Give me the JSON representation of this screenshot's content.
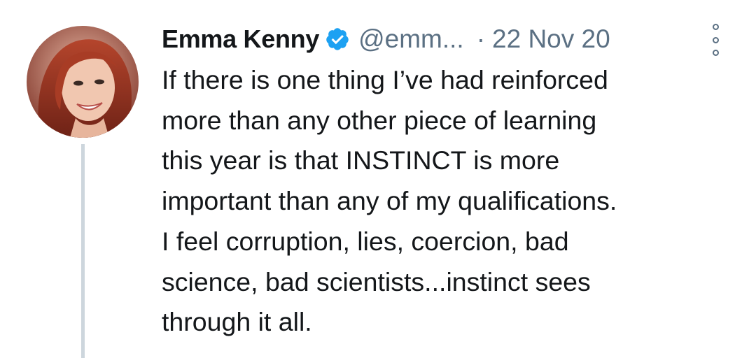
{
  "tweet": {
    "author": {
      "name": "Emma Kenny",
      "handle": "@emm...",
      "verified": true
    },
    "separator": "·",
    "date": "22 Nov 20",
    "text_lines": [
      "If there is one thing I’ve had reinforced",
      "more than any other piece of learning",
      "this year is that INSTINCT is more",
      "important than any of my qualifications.",
      "I feel corruption, lies, coercion, bad",
      "science, bad scientists...instinct sees",
      "through it all."
    ],
    "icons": {
      "verified": "verified-badge-icon",
      "more": "more-options-icon"
    }
  },
  "colors": {
    "verified_blue": "#1da1f2",
    "secondary_text": "#5b7083",
    "primary_text": "#14171a",
    "thread_line": "#cdd6dd"
  }
}
